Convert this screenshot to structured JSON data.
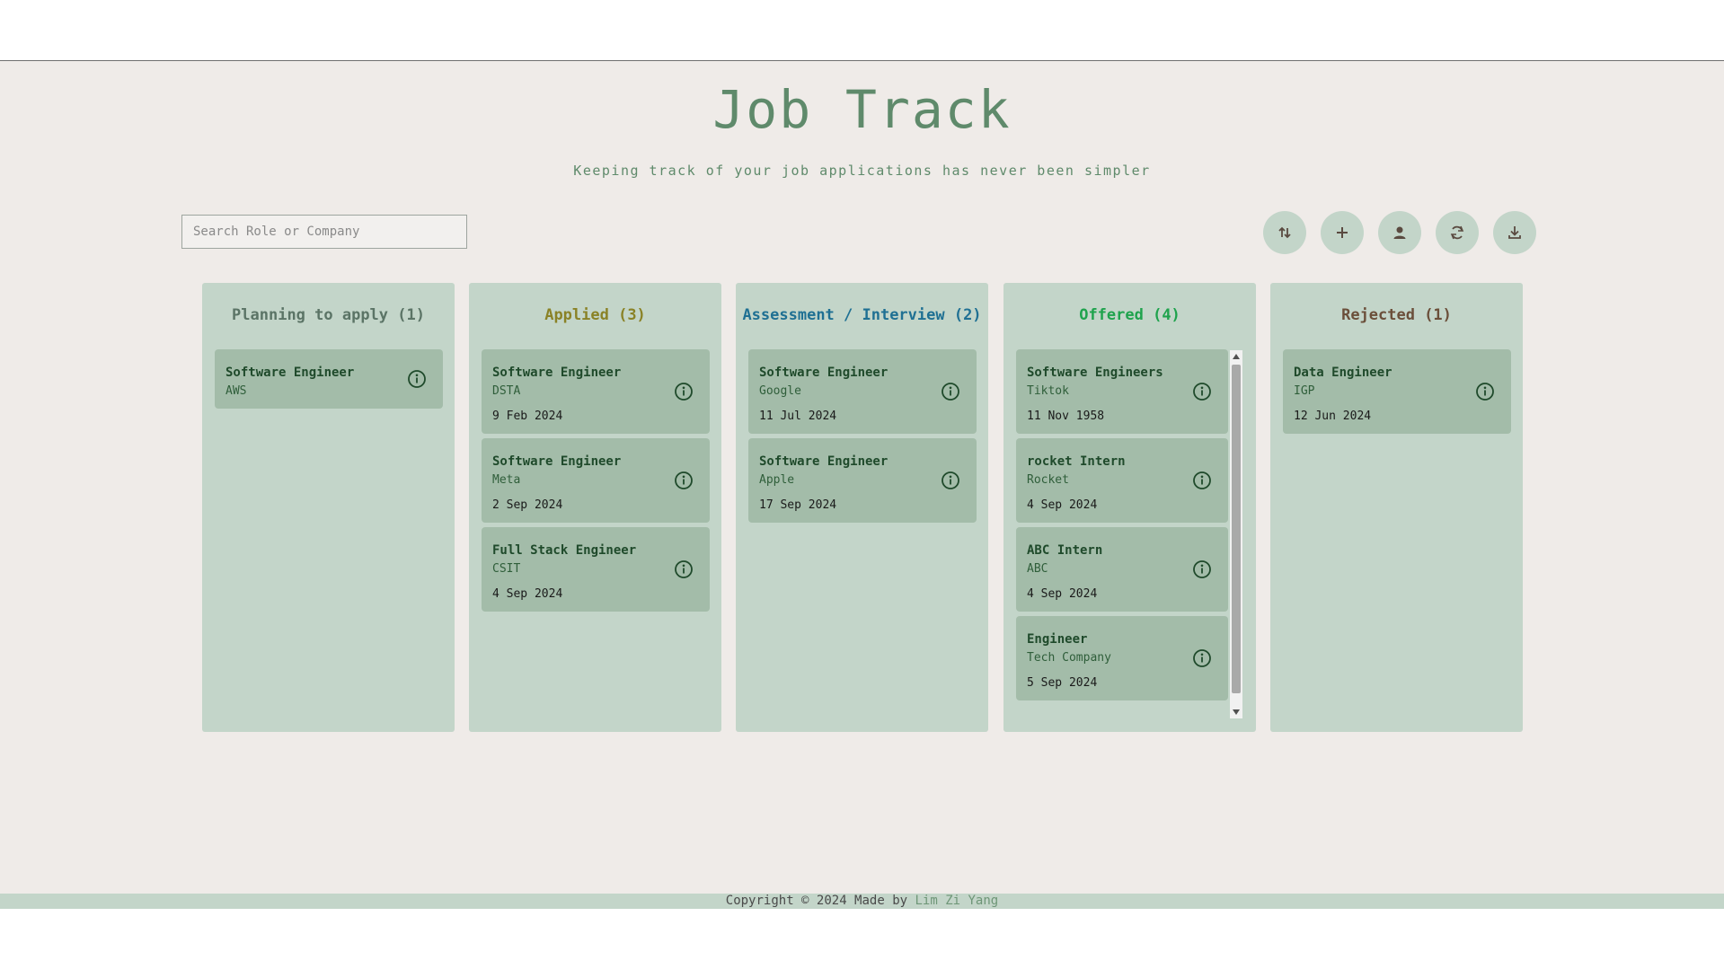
{
  "app": {
    "title": "Job Track",
    "subtitle": "Keeping track of your job applications has never been simpler"
  },
  "search": {
    "placeholder": "Search Role or Company",
    "value": ""
  },
  "toolbar": [
    {
      "name": "sort-button",
      "icon": "sort-arrows-icon"
    },
    {
      "name": "add-button",
      "icon": "plus-icon"
    },
    {
      "name": "profile-button",
      "icon": "user-icon"
    },
    {
      "name": "refresh-button",
      "icon": "refresh-icon"
    },
    {
      "name": "download-button",
      "icon": "download-icon"
    }
  ],
  "colors": {
    "accent": "#5f8a6b",
    "planning": "#5b7466",
    "applied": "#8a8226",
    "assessment": "#1f7093",
    "offered": "#1fa34d",
    "rejected": "#6b4f3a"
  },
  "columns": [
    {
      "id": "planning",
      "header": "Planning to apply (1)",
      "cards": [
        {
          "role": "Software Engineer",
          "company": "AWS",
          "date": ""
        }
      ]
    },
    {
      "id": "applied",
      "header": "Applied (3)",
      "cards": [
        {
          "role": "Software Engineer",
          "company": "DSTA",
          "date": "9 Feb 2024"
        },
        {
          "role": "Software Engineer",
          "company": "Meta",
          "date": "2 Sep 2024"
        },
        {
          "role": "Full Stack Engineer",
          "company": "CSIT",
          "date": "4 Sep 2024"
        }
      ]
    },
    {
      "id": "assessment",
      "header": "Assessment / Interview (2)",
      "cards": [
        {
          "role": "Software Engineer",
          "company": "Google",
          "date": "11 Jul 2024"
        },
        {
          "role": "Software Engineer",
          "company": "Apple",
          "date": "17 Sep 2024"
        }
      ]
    },
    {
      "id": "offered",
      "header": "Offered (4)",
      "cards": [
        {
          "role": "Software Engineers",
          "company": "Tiktok",
          "date": "11 Nov 1958"
        },
        {
          "role": "rocket Intern",
          "company": "Rocket",
          "date": "4 Sep 2024"
        },
        {
          "role": "ABC Intern",
          "company": "ABC",
          "date": "4 Sep 2024"
        },
        {
          "role": "Engineer",
          "company": "Tech Company",
          "date": "5 Sep 2024"
        }
      ]
    },
    {
      "id": "rejected",
      "header": "Rejected (1)",
      "cards": [
        {
          "role": "Data Engineer",
          "company": "IGP",
          "date": "12 Jun 2024"
        }
      ]
    }
  ],
  "footer": {
    "copyright": "Copyright © 2024 Made by",
    "author": "Lim Zi Yang"
  }
}
